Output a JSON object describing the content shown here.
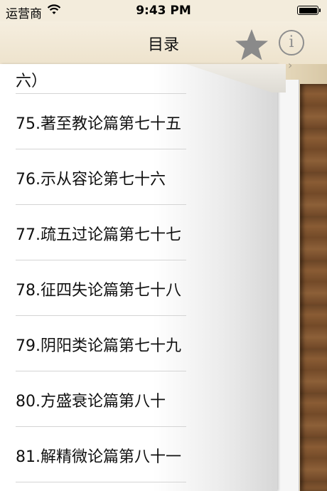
{
  "status_bar": {
    "carrier": "运营商",
    "time": "9:43 PM",
    "battery_level": 1.0
  },
  "nav": {
    "title": "目录",
    "star_icon": "star-icon",
    "info_icon": "info-icon",
    "info_glyph": "i"
  },
  "toc": {
    "items": [
      "六）",
      "75.著至教论篇第七十五",
      "76.示从容论第七十六",
      "77.疏五过论篇第七十七",
      "78.征四失论篇第七十八",
      "79.阴阳类论篇第七十九",
      "80.方盛衰论篇第八十",
      "81.解精微论篇第八十一"
    ]
  }
}
